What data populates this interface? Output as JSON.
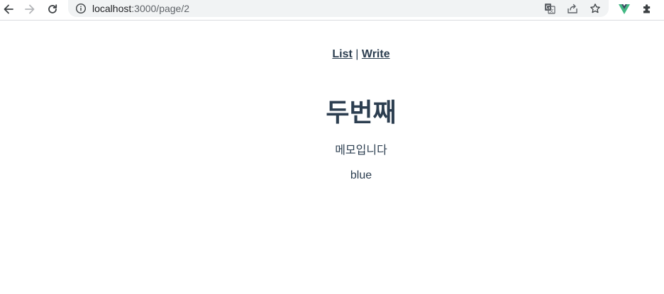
{
  "browser": {
    "url_host": "localhost",
    "url_path": ":3000/page/2",
    "icons": {
      "back": "arrow-left-icon",
      "forward": "arrow-right-icon",
      "reload": "reload-icon",
      "site_info": "info-icon",
      "translate": "translate-icon",
      "share": "share-icon",
      "bookmark": "star-icon",
      "vue_devtools": "vue-icon",
      "extensions": "puzzle-icon"
    },
    "colors": {
      "vue_green": "#42b883",
      "vue_dark": "#35495e"
    }
  },
  "nav": {
    "list_label": "List",
    "separator": "|",
    "write_label": "Write"
  },
  "memo": {
    "title": "두번째",
    "content": "메모입니다",
    "color": "blue"
  },
  "theme": {
    "text_color": "#2c3e50"
  }
}
